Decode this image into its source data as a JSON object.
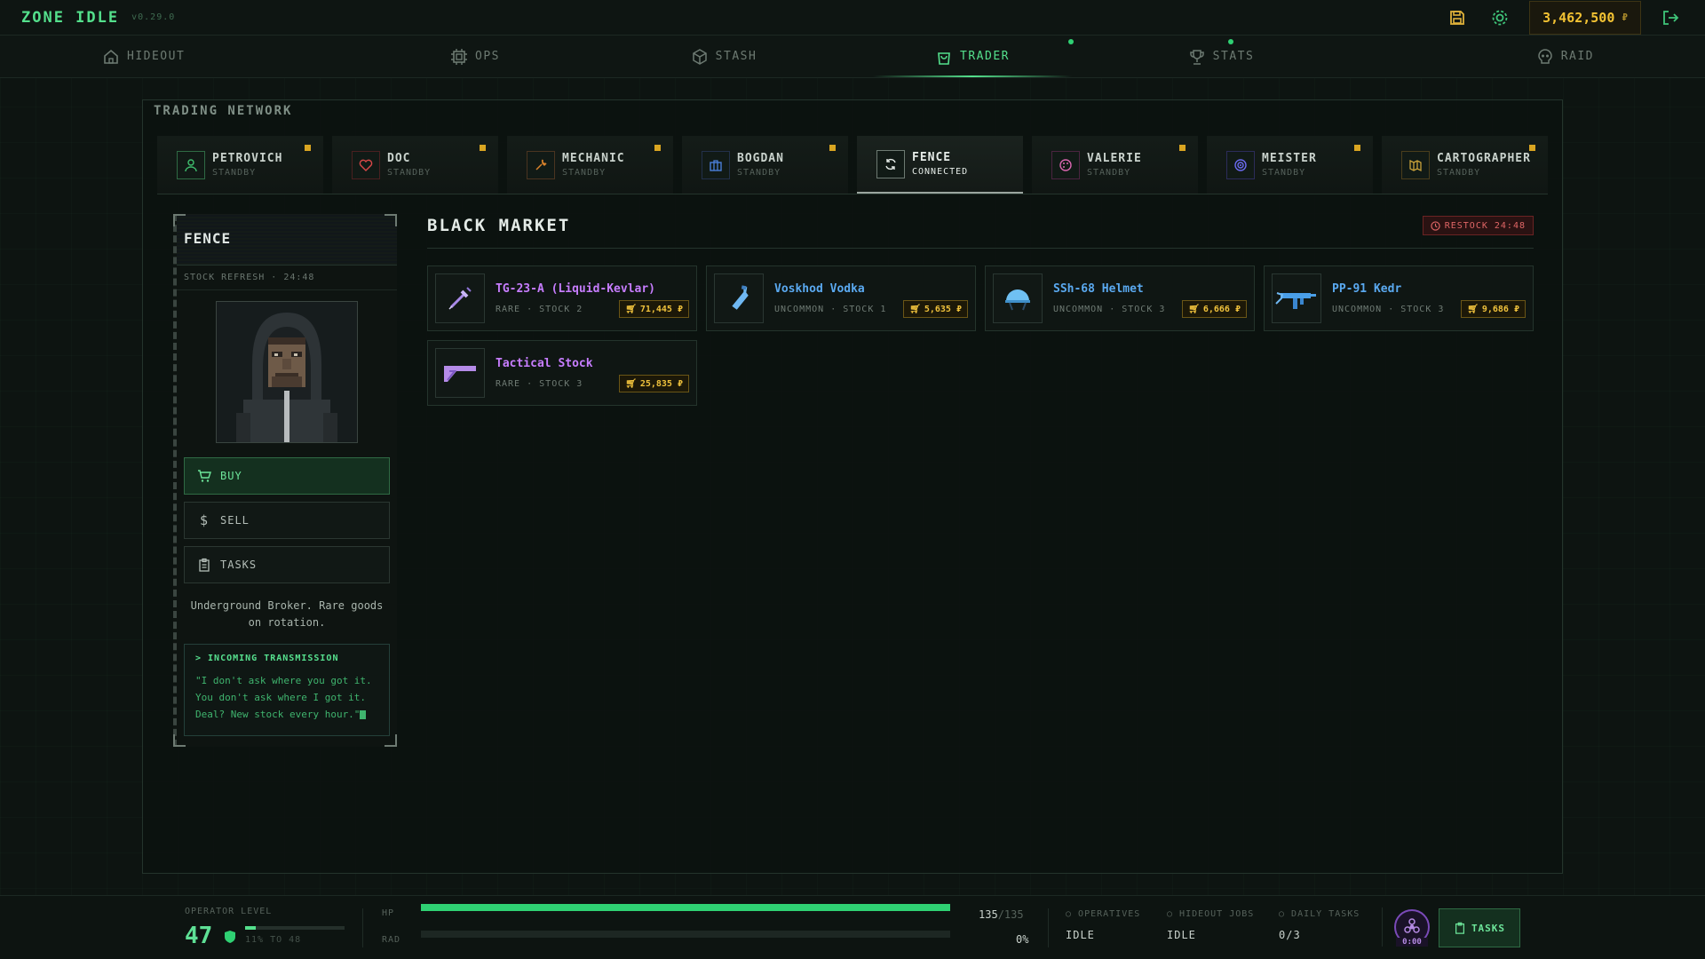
{
  "app": {
    "title": "ZONE IDLE",
    "version": "v0.29.0"
  },
  "header": {
    "money": "3,462,500",
    "currency": "₽"
  },
  "nav": [
    {
      "label": "HIDEOUT",
      "icon": "home-icon"
    },
    {
      "label": "OPS",
      "icon": "chip-icon"
    },
    {
      "label": "STASH",
      "icon": "box-icon"
    },
    {
      "label": "TRADER",
      "icon": "bag-icon",
      "active": true
    },
    {
      "label": "STATS",
      "icon": "trophy-icon"
    },
    {
      "label": "RAID",
      "icon": "skull-icon"
    }
  ],
  "trading": {
    "title": "TRADING NETWORK",
    "traders": [
      {
        "name": "PETROVICH",
        "status": "STANDBY",
        "icon": "person-icon",
        "color": "#3fbf6e"
      },
      {
        "name": "DOC",
        "status": "STANDBY",
        "icon": "heart-icon",
        "color": "#d94848"
      },
      {
        "name": "MECHANIC",
        "status": "STANDBY",
        "icon": "wrench-icon",
        "color": "#d9822b"
      },
      {
        "name": "BOGDAN",
        "status": "STANDBY",
        "icon": "briefcase-icon",
        "color": "#4a7fd9"
      },
      {
        "name": "FENCE",
        "status": "CONNECTED",
        "icon": "refresh-icon",
        "color": "#e6ece8"
      },
      {
        "name": "VALERIE",
        "status": "STANDBY",
        "icon": "palette-icon",
        "color": "#d966b0"
      },
      {
        "name": "MEISTER",
        "status": "STANDBY",
        "icon": "target-icon",
        "color": "#6b6bf0"
      },
      {
        "name": "CARTOGRAPHER",
        "status": "STANDBY",
        "icon": "map-icon",
        "color": "#c9a23a"
      }
    ]
  },
  "profile": {
    "name": "FENCE",
    "refresh": "STOCK REFRESH · 24:48",
    "buy": "BUY",
    "sell": "SELL",
    "tasks": "TASKS",
    "description": "Underground Broker. Rare goods on rotation.",
    "transmission_title": "> INCOMING TRANSMISSION",
    "transmission_text": "\"I don't ask where you got it. You don't ask where I got it. Deal? New stock every hour.\""
  },
  "market": {
    "title": "BLACK MARKET",
    "restock": "RESTOCK 24:48",
    "items": [
      {
        "name": "TG-23-A (Liquid-Kevlar)",
        "rarity": "RARE",
        "stock": "STOCK 2",
        "price": "71,445 ₽",
        "color": "#c77dff",
        "icon": "syringe-icon"
      },
      {
        "name": "Voskhod Vodka",
        "rarity": "UNCOMMON",
        "stock": "STOCK 1",
        "price": "5,635 ₽",
        "color": "#5aa9f0",
        "icon": "bottle-icon"
      },
      {
        "name": "SSh-68 Helmet",
        "rarity": "UNCOMMON",
        "stock": "STOCK 3",
        "price": "6,666 ₽",
        "color": "#5aa9f0",
        "icon": "helmet-icon"
      },
      {
        "name": "PP-91 Kedr",
        "rarity": "UNCOMMON",
        "stock": "STOCK 3",
        "price": "9,686 ₽",
        "color": "#5aa9f0",
        "icon": "smg-icon"
      },
      {
        "name": "Tactical Stock",
        "rarity": "RARE",
        "stock": "STOCK 3",
        "price": "25,835 ₽",
        "color": "#c77dff",
        "icon": "stock-icon"
      }
    ]
  },
  "footer": {
    "operator_label": "OPERATOR LEVEL",
    "level": "47",
    "next_level": "11% TO 48",
    "level_progress": 0.11,
    "hp_label": "HP",
    "hp_current": "135",
    "hp_max": "/135",
    "hp_fraction": 1.0,
    "rad_label": "RAD",
    "rad_value": "0%",
    "rad_fraction": 0.0,
    "operatives_label": "OPERATIVES",
    "operatives_value": "IDLE",
    "hideout_label": "HIDEOUT JOBS",
    "hideout_value": "IDLE",
    "daily_label": "DAILY TASKS",
    "daily_value": "0/3",
    "timer": "0:00",
    "tasks_button": "TASKS"
  }
}
